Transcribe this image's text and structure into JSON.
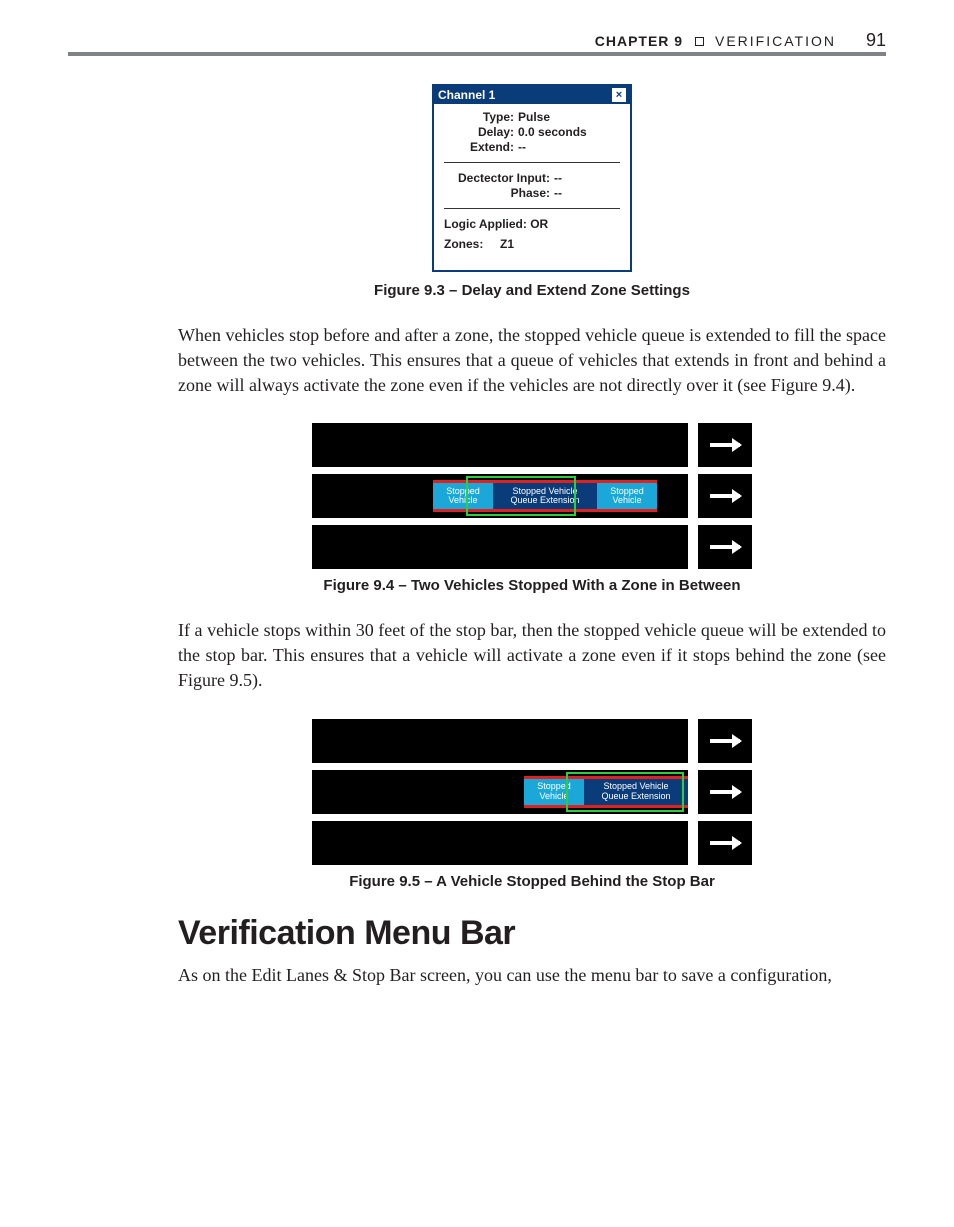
{
  "header": {
    "chapter_label": "CHAPTER 9",
    "section_name": "VERIFICATION",
    "page_number": "91"
  },
  "fig93": {
    "title": "Channel 1",
    "rows1": {
      "type_k": "Type:",
      "type_v": "Pulse",
      "delay_k": "Delay:",
      "delay_v": "0.0 seconds",
      "extend_k": "Extend:",
      "extend_v": "--"
    },
    "rows2": {
      "detector_k": "Dectector Input:",
      "detector_v": "--",
      "phase_k": "Phase:",
      "phase_v": "--"
    },
    "rows3": {
      "logic": "Logic Applied: OR",
      "zones_k": "Zones:",
      "zones_v": "Z1"
    },
    "caption": "Figure 9.3 – Delay and Extend Zone Settings"
  },
  "para1": "When vehicles stop before and after a zone, the stopped vehicle queue is extended to fill the space between the two vehicles. This ensures that a queue of vehicles that extends in front and behind a zone will always activate the zone even if the vehicles are not directly over it (see Figure 9.4).",
  "fig94": {
    "stopped": "Stopped Vehicle",
    "queue1": "Stopped Vehicle",
    "queue2": "Queue Extension",
    "caption": "Figure 9.4 – Two Vehicles Stopped With a Zone in Between"
  },
  "para2": "If a vehicle stops within 30 feet of the stop bar, then the stopped vehicle queue will be extended to the stop bar. This ensures that a vehicle will activate a zone even if it stops behind the zone (see Figure 9.5).",
  "fig95": {
    "stopped": "Stopped Vehicle",
    "queue1": "Stopped Vehicle",
    "queue2": "Queue Extension",
    "caption": "Figure 9.5 – A Vehicle Stopped Behind the Stop Bar"
  },
  "section_heading": "Verification Menu Bar",
  "para3": "As on the Edit Lanes & Stop Bar screen, you can use the menu bar to save a configuration,"
}
